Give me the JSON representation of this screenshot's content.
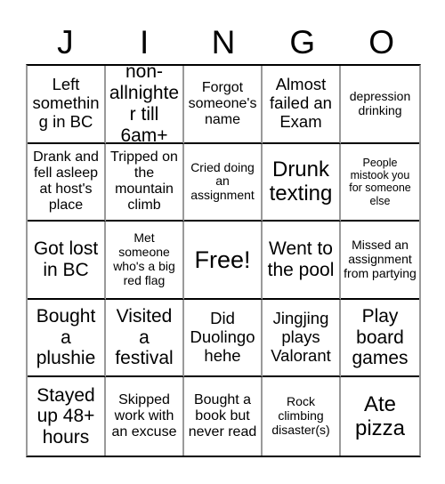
{
  "card": {
    "title_letters": [
      "J",
      "I",
      "N",
      "G",
      "O"
    ],
    "free_space_label": "Free!",
    "colors": {
      "background": "#ffffff",
      "text": "#000000",
      "grid_line_horizontal": "#000000",
      "grid_line_vertical": "#9a9a9a"
    },
    "columns": 5,
    "rows": 5,
    "cells": [
      {
        "text": "Left something in BC",
        "size": "lg"
      },
      {
        "text": "non-allnighter till 6am+",
        "size": "xl"
      },
      {
        "text": "Forgot someone's name",
        "size": "md"
      },
      {
        "text": "Almost failed an Exam",
        "size": "lg"
      },
      {
        "text": "depression drinking",
        "size": "sm"
      },
      {
        "text": "Drank and fell asleep at host's place",
        "size": "md"
      },
      {
        "text": "Tripped on the mountain climb",
        "size": "md"
      },
      {
        "text": "Cried doing an assignment",
        "size": "sm"
      },
      {
        "text": "Drunk texting",
        "size": "xxl"
      },
      {
        "text": "People mistook you for someone else",
        "size": "xs"
      },
      {
        "text": "Got lost in BC",
        "size": "xl"
      },
      {
        "text": "Met someone who's a big red flag",
        "size": "sm"
      },
      {
        "text": "Free!",
        "size": "free"
      },
      {
        "text": "Went to the pool",
        "size": "xl"
      },
      {
        "text": "Missed an assignment from partying",
        "size": "sm"
      },
      {
        "text": "Bought a plushie",
        "size": "xl"
      },
      {
        "text": "Visited a festival",
        "size": "xl"
      },
      {
        "text": "Did Duolingo hehe",
        "size": "lg"
      },
      {
        "text": "Jingjing plays Valorant",
        "size": "lg"
      },
      {
        "text": "Play board games",
        "size": "xl"
      },
      {
        "text": "Stayed up 48+ hours",
        "size": "xl"
      },
      {
        "text": "Skipped work with an excuse",
        "size": "md"
      },
      {
        "text": "Bought a book but never read",
        "size": "md"
      },
      {
        "text": "Rock climbing disaster(s)",
        "size": "sm"
      },
      {
        "text": "Ate pizza",
        "size": "xxl"
      }
    ]
  }
}
